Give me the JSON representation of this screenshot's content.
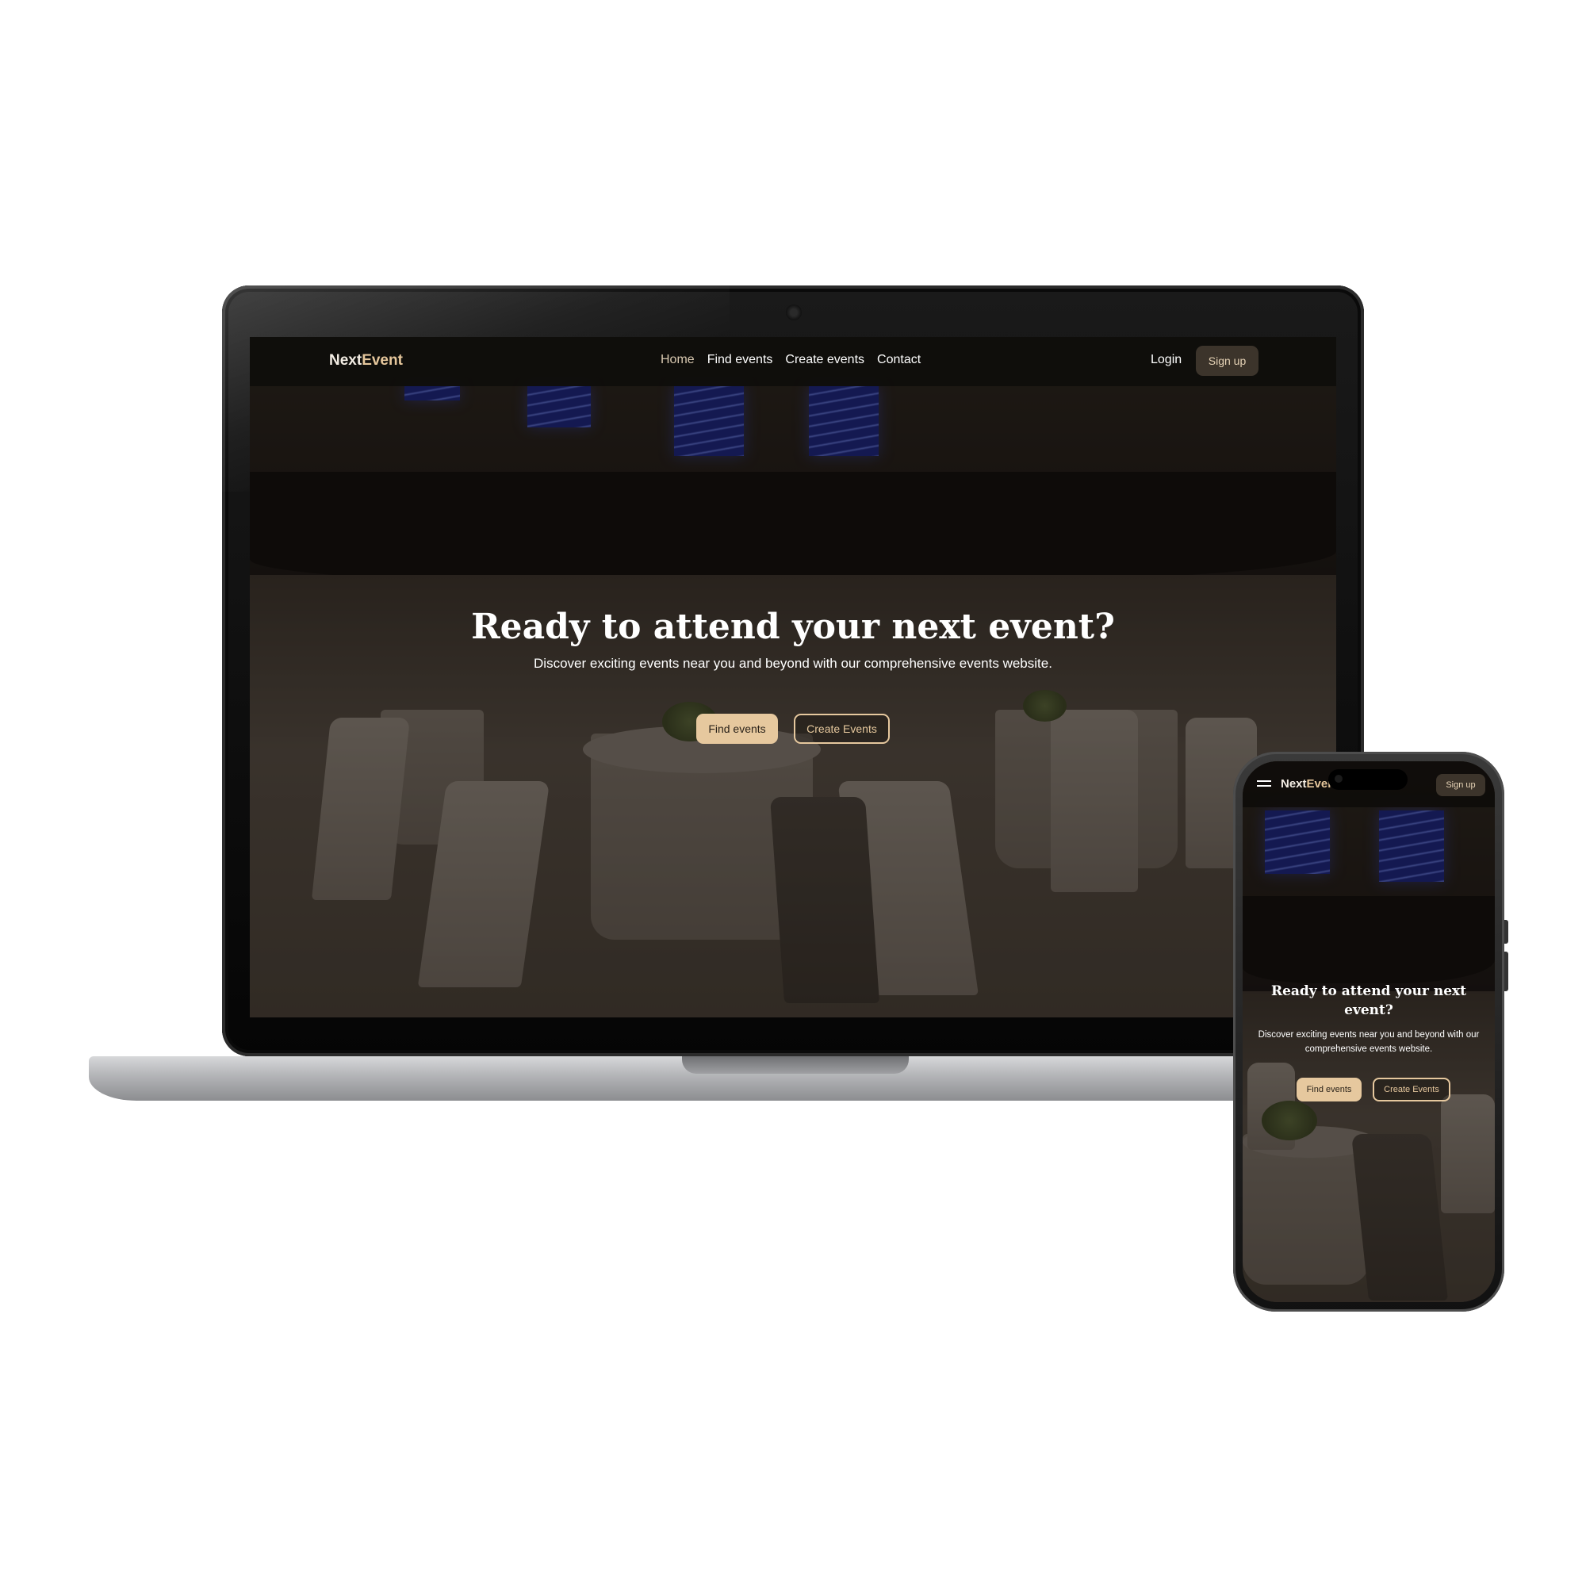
{
  "desktop": {
    "nav": {
      "logo_prefix": "Next",
      "logo_accent": "Event",
      "links": [
        "Home",
        "Find events",
        "Create events",
        "Contact"
      ],
      "active_link": "Home",
      "login": "Login",
      "signup": "Sign up"
    },
    "hero": {
      "title": "Ready to attend your next event?",
      "subtitle": "Discover exciting events near you and beyond with our comprehensive events website.",
      "primary_button": "Find events",
      "secondary_button": "Create Events"
    }
  },
  "mobile": {
    "nav": {
      "menu_icon": "hamburger-icon",
      "logo_prefix": "Next",
      "logo_accent": "Event",
      "signup": "Sign up"
    },
    "hero": {
      "title": "Ready to attend your next event?",
      "subtitle": "Discover exciting events near you and beyond with our comprehensive events website.",
      "primary_button": "Find events",
      "secondary_button": "Create Events"
    }
  },
  "colors": {
    "accent": "#e6c89e",
    "nav_background": "#0e0c0a",
    "signup_button": "#3c342b"
  }
}
